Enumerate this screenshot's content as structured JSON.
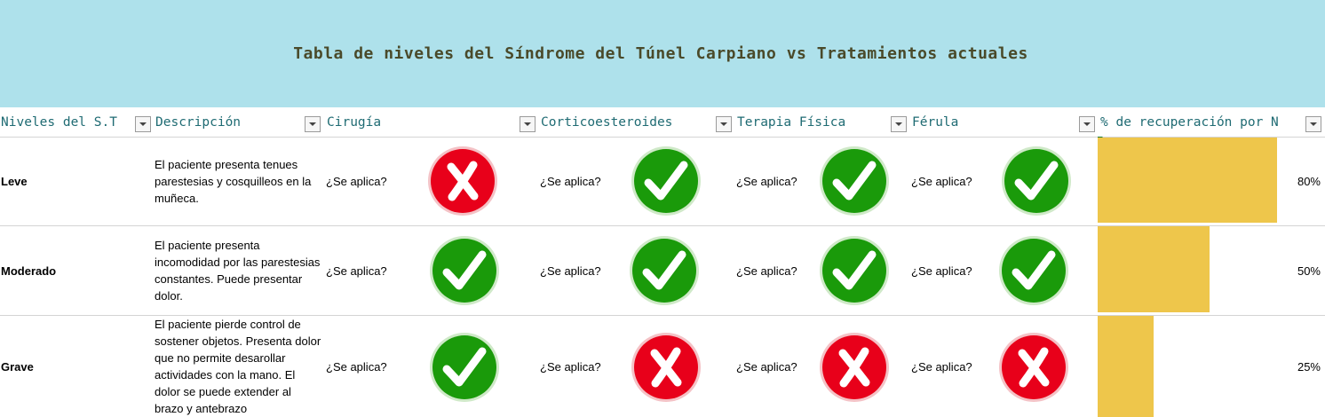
{
  "title": "Tabla de niveles del Síndrome del Túnel Carpiano vs Tratamientos actuales",
  "headers": {
    "niveles": "Niveles del S.T",
    "descripcion": "Descripción",
    "cirugia": "Cirugía",
    "corticoesteroides": "Corticoesteroides",
    "terapia": "Terapia Física",
    "ferula": "Férula",
    "recuperacion": "% de recuperación por N"
  },
  "question_label": "¿Se aplica?",
  "rows": [
    {
      "level": "Leve",
      "description": "El paciente presenta tenues parestesias y cosquilleos en la muñeca.",
      "cirugia": "no",
      "corticoesteroides": "yes",
      "terapia": "yes",
      "ferula": "yes",
      "recovery_label": "80%",
      "recovery_value": 0.8
    },
    {
      "level": "Moderado",
      "description": "El paciente presenta incomodidad por las parestesias constantes. Puede presentar dolor.",
      "cirugia": "yes",
      "corticoesteroides": "yes",
      "terapia": "yes",
      "ferula": "yes",
      "recovery_label": "50%",
      "recovery_value": 0.5
    },
    {
      "level": "Grave",
      "description": "El paciente pierde control de sostener objetos. Presenta dolor que no permite desarollar actividades con la mano. El dolor se puede extender al brazo y antebrazo",
      "cirugia": "yes",
      "corticoesteroides": "no",
      "terapia": "no",
      "ferula": "no",
      "recovery_label": "25%",
      "recovery_value": 0.25
    }
  ],
  "colors": {
    "title_band": "#aee1eb",
    "header_text": "#1f6b73",
    "yes_icon": "#1a9a0a",
    "no_icon": "#e8001a",
    "bar": "#eec64b"
  },
  "icons": {
    "yes": "check-circle-icon",
    "no": "x-circle-icon"
  }
}
